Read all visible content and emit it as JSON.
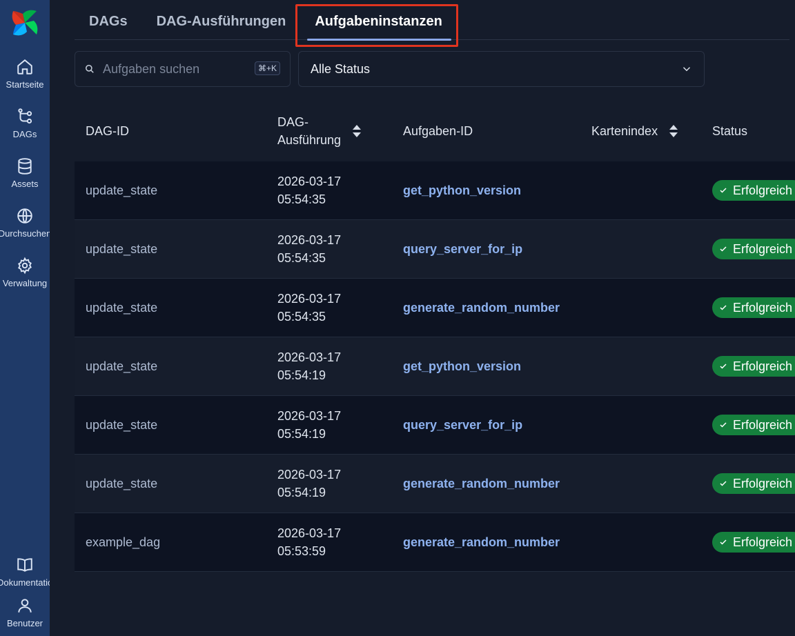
{
  "sidebar": {
    "items": [
      {
        "label": "Startseite",
        "icon": "home-icon"
      },
      {
        "label": "DAGs",
        "icon": "dag-icon"
      },
      {
        "label": "Assets",
        "icon": "database-icon"
      },
      {
        "label": "Durchsuchen",
        "icon": "globe-icon"
      },
      {
        "label": "Verwaltung",
        "icon": "gear-icon"
      }
    ],
    "bottom": [
      {
        "label": "Dokumentation",
        "icon": "book-icon"
      },
      {
        "label": "Benutzer",
        "icon": "user-icon"
      }
    ]
  },
  "tabs": [
    {
      "label": "DAGs"
    },
    {
      "label": "DAG-Ausführungen"
    },
    {
      "label": "Aufgabeninstanzen"
    }
  ],
  "search": {
    "placeholder": "Aufgaben suchen",
    "shortcut": "⌘+K"
  },
  "status_filter": {
    "selected": "Alle Status"
  },
  "table": {
    "headers": {
      "dag_id": "DAG-ID",
      "dag_run": "DAG-Ausführung",
      "task_id": "Aufgaben-ID",
      "map_index": "Kartenindex",
      "status": "Status"
    },
    "rows": [
      {
        "dag_id": "update_state",
        "date": "2026-03-17",
        "time": "05:54:35",
        "task_id": "get_python_version",
        "status": "Erfolgreich"
      },
      {
        "dag_id": "update_state",
        "date": "2026-03-17",
        "time": "05:54:35",
        "task_id": "query_server_for_ip",
        "status": "Erfolgreich"
      },
      {
        "dag_id": "update_state",
        "date": "2026-03-17",
        "time": "05:54:35",
        "task_id": "generate_random_number",
        "status": "Erfolgreich"
      },
      {
        "dag_id": "update_state",
        "date": "2026-03-17",
        "time": "05:54:19",
        "task_id": "get_python_version",
        "status": "Erfolgreich"
      },
      {
        "dag_id": "update_state",
        "date": "2026-03-17",
        "time": "05:54:19",
        "task_id": "query_server_for_ip",
        "status": "Erfolgreich"
      },
      {
        "dag_id": "update_state",
        "date": "2026-03-17",
        "time": "05:54:19",
        "task_id": "generate_random_number",
        "status": "Erfolgreich"
      },
      {
        "dag_id": "example_dag",
        "date": "2026-03-17",
        "time": "05:53:59",
        "task_id": "generate_random_number",
        "status": "Erfolgreich"
      }
    ]
  },
  "colors": {
    "sidebar": "#1f3a68",
    "success": "#15803d",
    "link": "#8eb2ef",
    "highlight": "#e0341f"
  }
}
